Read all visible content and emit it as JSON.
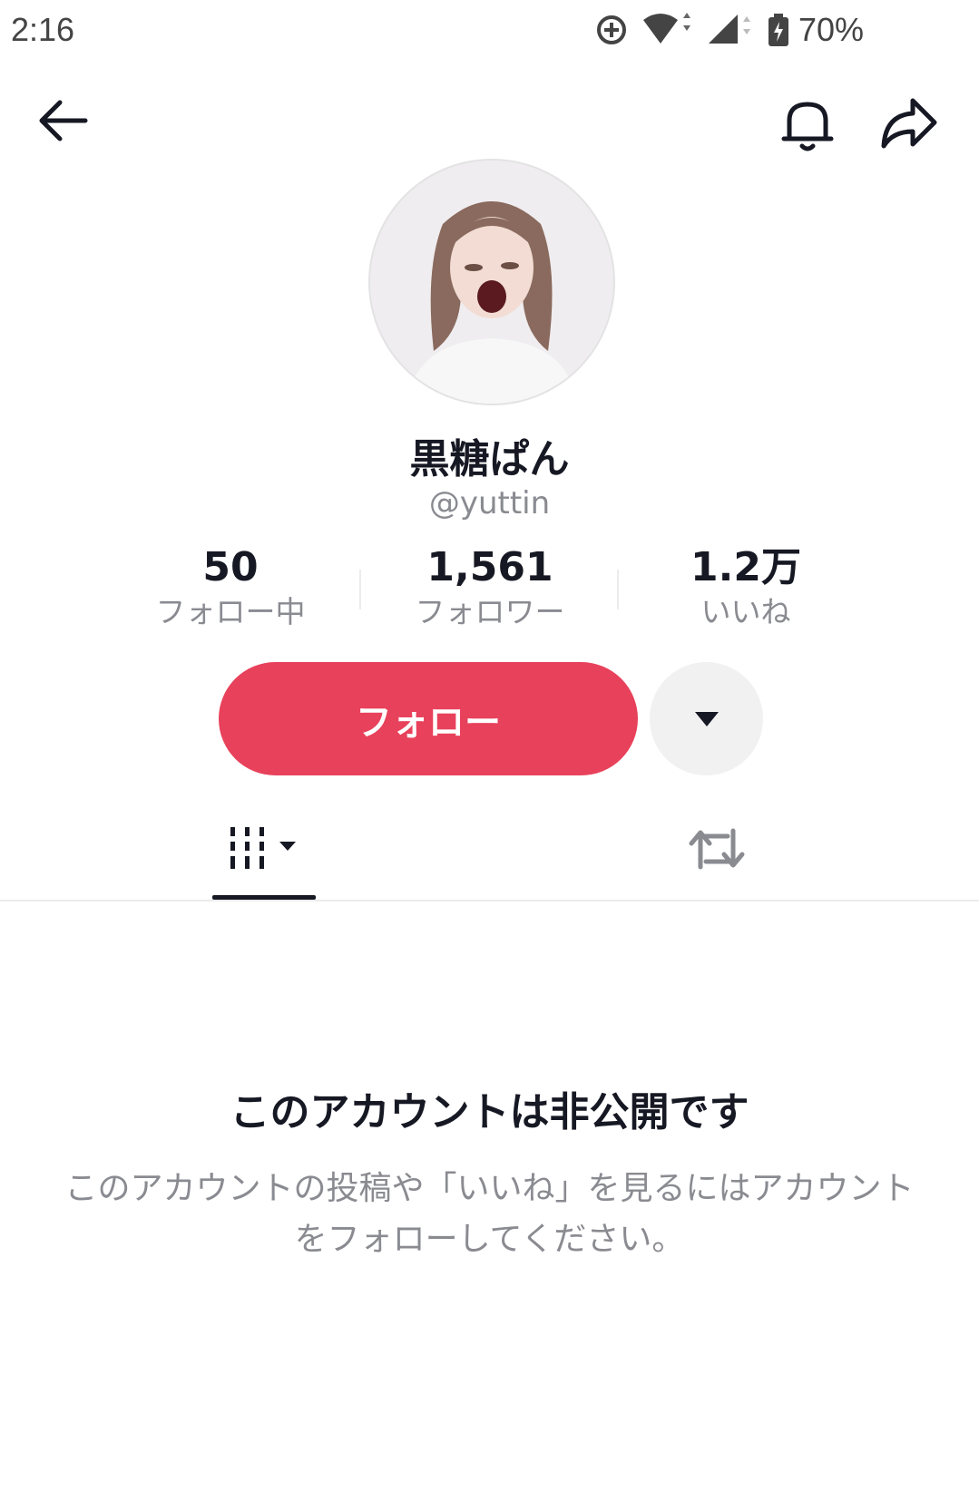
{
  "status_bar": {
    "time": "2:16",
    "battery": "70%",
    "icons": [
      "data-saver-icon",
      "wifi-icon",
      "signal-icon",
      "battery-charging-icon"
    ]
  },
  "header": {
    "back_icon": "arrow-left-icon",
    "bell_icon": "bell-icon",
    "share_icon": "share-arrow-icon"
  },
  "profile": {
    "display_name": "黒糖ぱん",
    "username": "@yuttin",
    "stats": [
      {
        "value": "50",
        "label": "フォロー中"
      },
      {
        "value": "1,561",
        "label": "フォロワー"
      },
      {
        "value": "1.2万",
        "label": "いいね"
      }
    ]
  },
  "actions": {
    "follow_label": "フォロー",
    "more_icon": "caret-down-icon"
  },
  "tabs": [
    {
      "icon": "videos-grid-icon",
      "active": true
    },
    {
      "icon": "repost-icon",
      "active": false
    }
  ],
  "private": {
    "title": "このアカウントは非公開です",
    "description": "このアカウントの投稿や「いいね」を見るにはアカウントをフォローしてください。"
  },
  "colors": {
    "accent": "#e8415b",
    "text_primary": "#161823",
    "text_secondary": "#8a8b91"
  }
}
